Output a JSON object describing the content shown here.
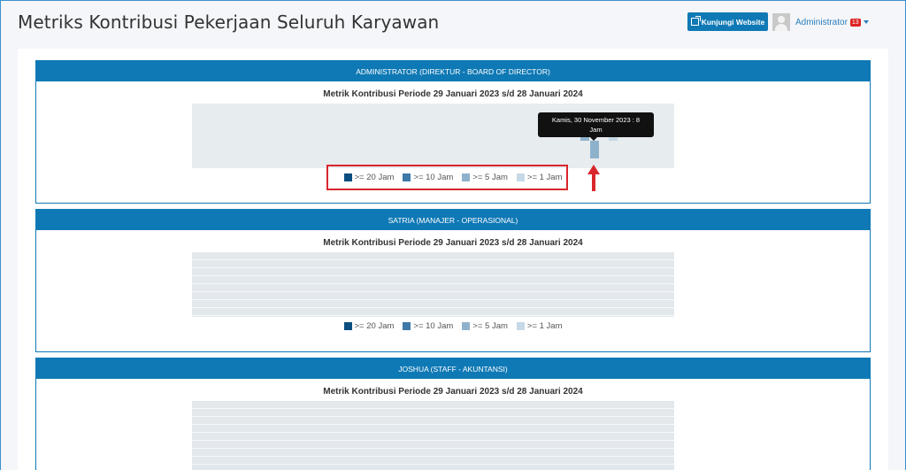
{
  "header": {
    "title": "Metriks Kontribusi Pekerjaan Seluruh Karyawan",
    "visit_button": "Kunjungi Website",
    "user_name": "Administrator",
    "notif_count": "13"
  },
  "legend": [
    {
      "label": ">= 20 Jam",
      "color": "#0b4e80"
    },
    {
      "label": ">= 10 Jam",
      "color": "#3f79a8"
    },
    {
      "label": ">= 5 Jam",
      "color": "#8fb2cc"
    },
    {
      "label": ">= 1 Jam",
      "color": "#c7d8e6"
    }
  ],
  "cards": [
    {
      "header": "ADMINISTRATOR (DIREKTUR - BOARD OF DIRECTOR)",
      "metric_title": "Metrik Kontribusi Periode 29 Januari 2023 s/d 28 Januari 2024",
      "tooltip_line1": "Kamis, 30 November 2023 : 8",
      "tooltip_line2": "Jam"
    },
    {
      "header": "SATRIA (MANAJER - OPERASIONAL)",
      "metric_title": "Metrik Kontribusi Periode 29 Januari 2023 s/d 28 Januari 2024"
    },
    {
      "header": "JOSHUA (STAFF - AKUNTANSI)",
      "metric_title": "Metrik Kontribusi Periode 29 Januari 2023 s/d 28 Januari 2024"
    }
  ],
  "colors": {
    "primary": "#0f79b5",
    "highlight": "#d9262c",
    "badge": "#dd2222"
  },
  "icons": [
    "external-link-icon",
    "avatar-icon",
    "caret-down-icon",
    "up-arrow-icon"
  ]
}
